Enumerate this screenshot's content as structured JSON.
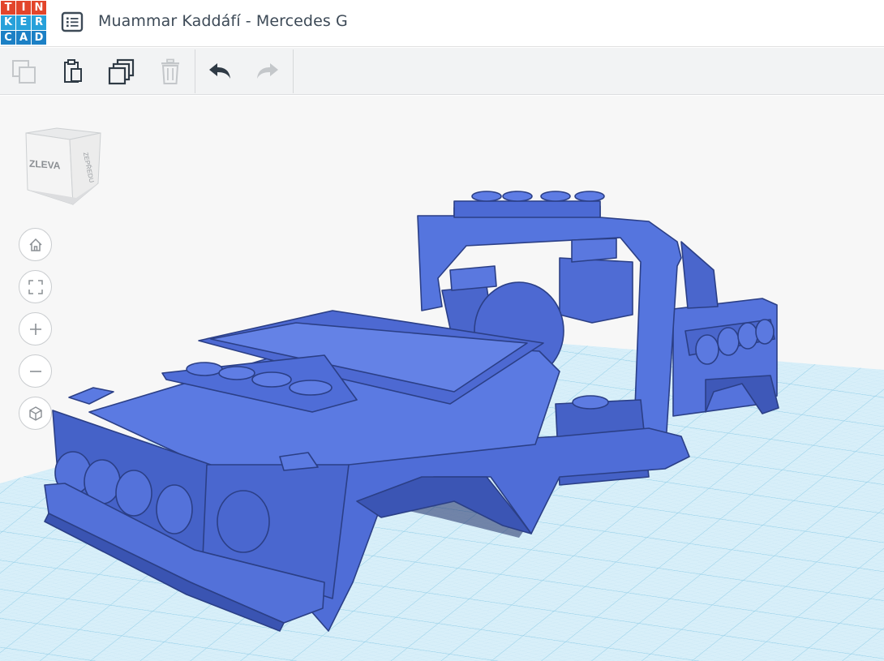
{
  "app": {
    "logo_letters": [
      "T",
      "I",
      "N",
      "K",
      "E",
      "R",
      "C",
      "A",
      "D"
    ],
    "logo_colors": [
      "#e2452b",
      "#e2452b",
      "#e2452b",
      "#27a1da",
      "#27a1da",
      "#27a1da",
      "#1c80c5",
      "#1c80c5",
      "#1c80c5"
    ],
    "design_title": "Muammar Kaddáfí - Mercedes G"
  },
  "toolbar": {
    "buttons": [
      {
        "name": "copy",
        "icon": "copy-icon",
        "enabled": false
      },
      {
        "name": "paste",
        "icon": "paste-icon",
        "enabled": true
      },
      {
        "name": "duplicate",
        "icon": "duplicate-icon",
        "enabled": true
      },
      {
        "name": "delete",
        "icon": "trash-icon",
        "enabled": false
      },
      {
        "name": "undo",
        "icon": "undo-icon",
        "enabled": true
      },
      {
        "name": "redo",
        "icon": "redo-icon",
        "enabled": false
      }
    ]
  },
  "viewcube": {
    "left_label": "ZLEVA",
    "front_label": "ZEPŘEDU"
  },
  "view_controls": [
    {
      "name": "home",
      "icon": "home-icon"
    },
    {
      "name": "fit-all",
      "icon": "fit-view-icon"
    },
    {
      "name": "zoom-in",
      "icon": "plus-icon"
    },
    {
      "name": "zoom-out",
      "icon": "minus-icon"
    },
    {
      "name": "perspective",
      "icon": "cube-icon"
    }
  ],
  "colors": {
    "model": "#4f6fd6",
    "grid": "#a9d7ee",
    "workplane": "#cfeaf7",
    "title_text": "#3d4a57"
  }
}
